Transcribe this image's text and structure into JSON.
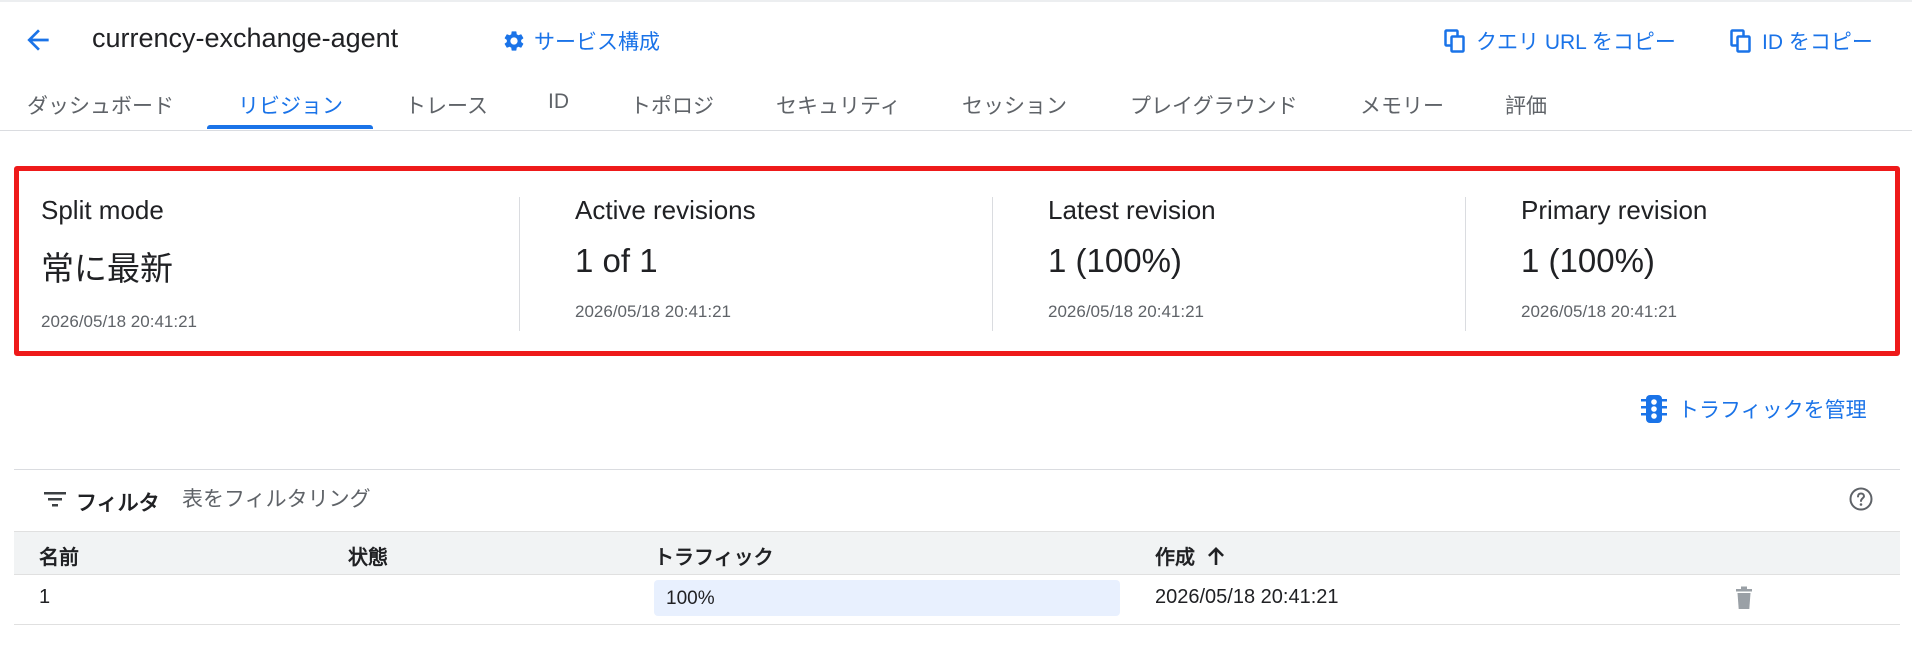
{
  "header": {
    "title": "currency-exchange-agent",
    "service_config": "サービス構成",
    "copy_query_url": "クエリ URL をコピー",
    "copy_id": "ID をコピー"
  },
  "tabs": [
    {
      "label": "ダッシュボード"
    },
    {
      "label": "リビジョン",
      "active": true
    },
    {
      "label": "トレース"
    },
    {
      "label": "ID"
    },
    {
      "label": "トポロジ"
    },
    {
      "label": "セキュリティ"
    },
    {
      "label": "セッション"
    },
    {
      "label": "プレイグラウンド"
    },
    {
      "label": "メモリー"
    },
    {
      "label": "評価"
    }
  ],
  "summary": [
    {
      "label": "Split mode",
      "value": "常に最新",
      "timestamp": "2026/05/18 20:41:21"
    },
    {
      "label": "Active revisions",
      "value": "1 of 1",
      "timestamp": "2026/05/18 20:41:21"
    },
    {
      "label": "Latest revision",
      "value": "1 (100%)",
      "timestamp": "2026/05/18 20:41:21"
    },
    {
      "label": "Primary revision",
      "value": "1 (100%)",
      "timestamp": "2026/05/18 20:41:21"
    }
  ],
  "manage_traffic": "トラフィックを管理",
  "filter": {
    "label": "フィルタ",
    "placeholder": "表をフィルタリング"
  },
  "table": {
    "columns": [
      "名前",
      "状態",
      "トラフィック",
      "作成"
    ],
    "rows": [
      {
        "name": "1",
        "status": "",
        "traffic": "100%",
        "created": "2026/05/18 20:41:21"
      }
    ]
  },
  "colors": {
    "accent": "#1a73e8",
    "highlight_border": "#ee1a1a",
    "traffic_fill": "#e8f0fe"
  },
  "icons": [
    "arrow-back-icon",
    "gear-icon",
    "copy-icon",
    "traffic-light-icon",
    "filter-icon",
    "help-icon",
    "arrow-up-icon",
    "trash-icon"
  ]
}
